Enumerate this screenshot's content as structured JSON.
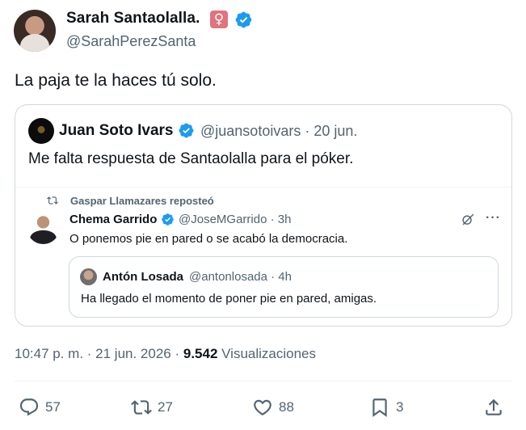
{
  "tweet": {
    "author_name": "Sarah Santaolalla.",
    "author_badge": "♀",
    "author_handle": "@SarahPerezSanta",
    "text": "La paja te la haces tú solo.",
    "timestamp": "10:47 p. m. · 21 jun. 2026 · ",
    "views_count": "9.542",
    "views_label": " Visualizaciones"
  },
  "quoted": {
    "author_name": "Juan Soto Ivars",
    "handle_date": "@juansotoivars · 20 jun.",
    "text": "Me falta respuesta de Santaolalla para el póker."
  },
  "embedded": {
    "repost_text": "Gaspar Llamazares reposteó",
    "author_name": "Chema Garrido",
    "handle_time": "@JoseMGarrido · 3h",
    "text": "O ponemos pie en pared o se acabó la democracia.",
    "more": "···"
  },
  "inner_quote": {
    "author_name": "Antón Losada",
    "handle_time": "@antonlosada · 4h",
    "text": "Ha llegado el momento de poner pie en pared, amigas."
  },
  "actions": {
    "replies": "57",
    "reposts": "27",
    "likes": "88",
    "bookmarks": "3"
  },
  "icons": {
    "verified": "verified-badge-icon",
    "reply": "reply-icon",
    "repost": "repost-icon",
    "like": "heart-icon",
    "bookmark": "bookmark-icon",
    "share": "share-icon",
    "grok": "grok-icon",
    "more": "more-icon"
  },
  "colors": {
    "verified": "#1d9bf0",
    "badge_female": "#e0737c",
    "text_primary": "#0f1419",
    "text_secondary": "#536471",
    "border": "#cfd9de"
  }
}
